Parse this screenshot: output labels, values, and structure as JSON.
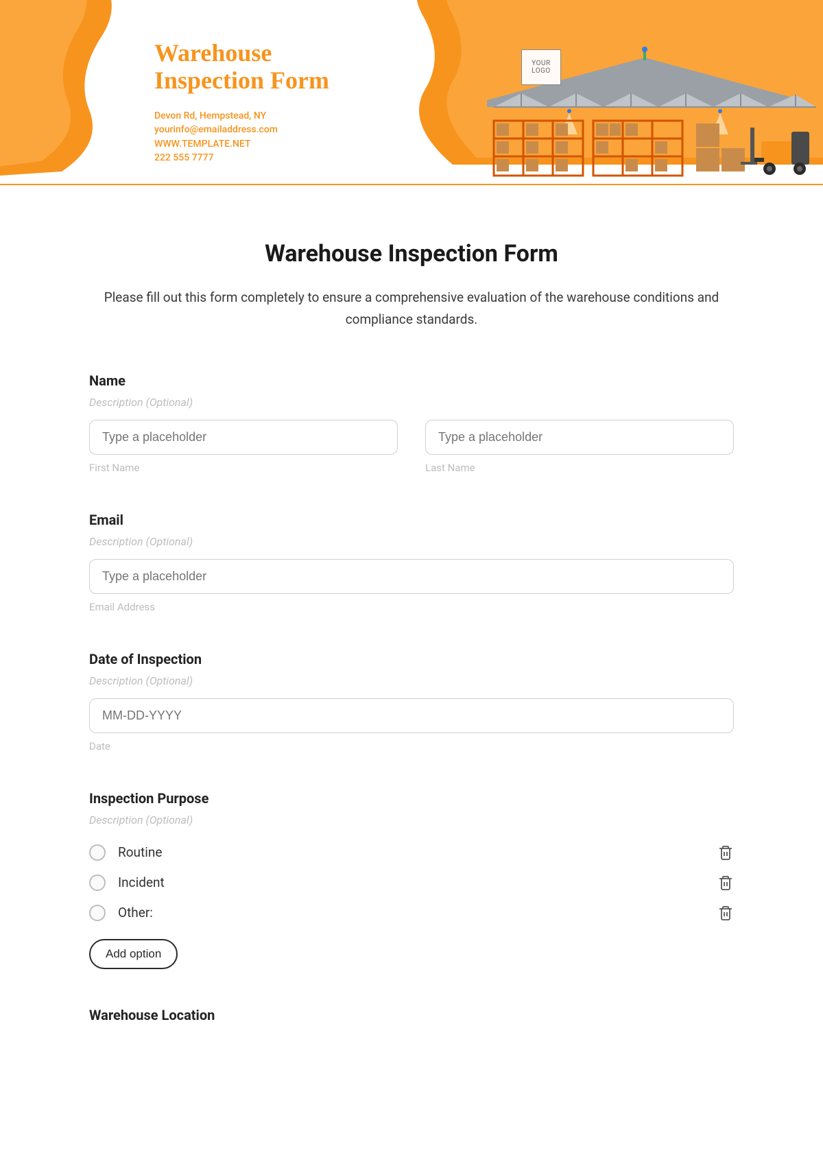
{
  "header": {
    "title_line1": "Warehouse",
    "title_line2": "Inspection Form",
    "address": "Devon Rd, Hempstead, NY",
    "email": "yourinfo@emailaddress.com",
    "website": "WWW.TEMPLATE.NET",
    "phone": "222 555 7777",
    "logo_text": "YOUR LOGO"
  },
  "page": {
    "title": "Warehouse Inspection Form",
    "intro": "Please fill out this form completely to ensure a comprehensive evaluation of the warehouse conditions and compliance standards."
  },
  "fields": {
    "name": {
      "label": "Name",
      "desc": "Description (Optional)",
      "first_placeholder": "Type a placeholder",
      "first_sub": "First Name",
      "last_placeholder": "Type a placeholder",
      "last_sub": "Last Name"
    },
    "email": {
      "label": "Email",
      "desc": "Description (Optional)",
      "placeholder": "Type a placeholder",
      "sub": "Email Address"
    },
    "date": {
      "label": "Date of Inspection",
      "desc": "Description (Optional)",
      "placeholder": "MM-DD-YYYY",
      "sub": "Date"
    },
    "purpose": {
      "label": "Inspection Purpose",
      "desc": "Description (Optional)",
      "options": [
        "Routine",
        "Incident",
        "Other:"
      ],
      "add_label": "Add option"
    },
    "location": {
      "label": "Warehouse Location"
    }
  }
}
